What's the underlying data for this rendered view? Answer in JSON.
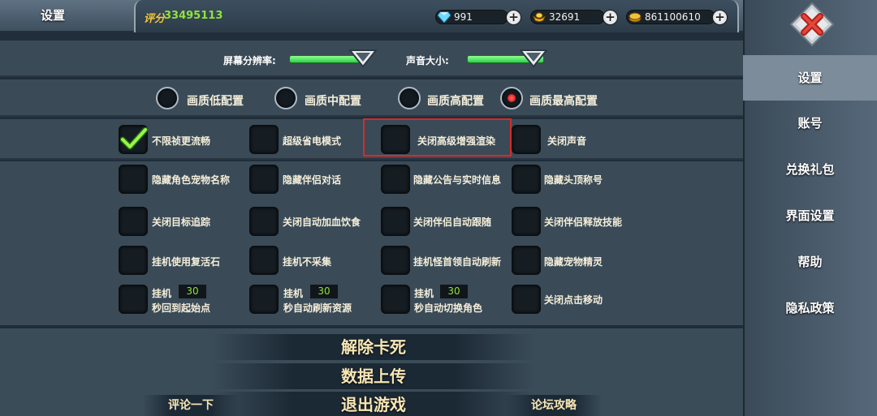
{
  "header": {
    "title": "设置",
    "score_label": "评分",
    "score_value": "33495113",
    "currencies": [
      {
        "icon": "diamond-icon",
        "value": "991"
      },
      {
        "icon": "gold-ingot-icon",
        "value": "32691"
      },
      {
        "icon": "coin-icon",
        "value": "861100610"
      }
    ]
  },
  "sidebar": {
    "items": [
      {
        "label": "设置",
        "active": true
      },
      {
        "label": "账号"
      },
      {
        "label": "兑换礼包"
      },
      {
        "label": "界面设置"
      },
      {
        "label": "帮助"
      },
      {
        "label": "隐私政策"
      }
    ]
  },
  "sliders": {
    "resolution_label": "屏幕分辨率:",
    "resolution_level": 0.95,
    "volume_label": "声音大小:",
    "volume_level": 0.95
  },
  "quality": {
    "options": [
      "画质低配置",
      "画质中配置",
      "画质高配置",
      "画质最高配置"
    ],
    "selected_index": 3
  },
  "options": {
    "row1": [
      "不限祯更流畅",
      "超级省电模式",
      "关闭高级增强渲染",
      "关闭声音"
    ],
    "row1_checked": [
      true,
      false,
      false,
      false
    ],
    "row2": [
      "隐藏角色宠物名称",
      "隐藏伴侣对话",
      "隐藏公告与实时信息",
      "隐藏头顶称号"
    ],
    "row3": [
      "关闭目标追踪",
      "关闭自动加血饮食",
      "关闭伴侣自动跟随",
      "关闭伴侣释放技能"
    ],
    "row4": [
      "挂机使用复活石",
      "挂机不采集",
      "挂机怪首领自动刷新",
      "隐藏宠物精灵"
    ],
    "row5": [
      {
        "prefix": "挂机",
        "value": "30",
        "suffix": "秒回到起始点"
      },
      {
        "prefix": "挂机",
        "value": "30",
        "suffix": "秒自动刷新资源"
      },
      {
        "prefix": "挂机",
        "value": "30",
        "suffix": "秒自动切换角色"
      }
    ],
    "row5_last": "关闭点击移动"
  },
  "buttons": {
    "unstuck": "解除卡死",
    "upload": "数据上传",
    "exit": "退出游戏",
    "review": "评论一下",
    "forum": "论坛攻略"
  },
  "colors": {
    "accent_green": "#8fe33b",
    "selected_red": "#d40000",
    "highlight_border": "#d72a2a"
  }
}
